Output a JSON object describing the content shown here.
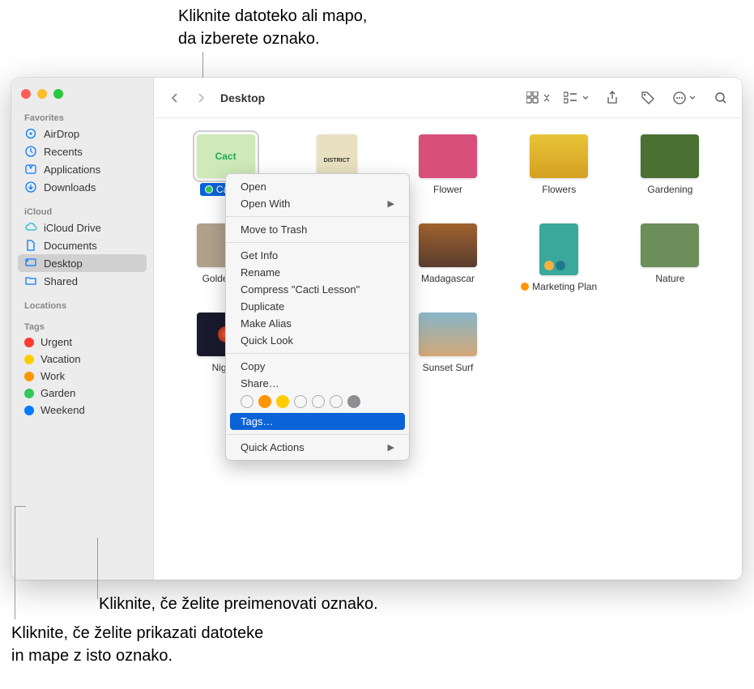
{
  "annotations": {
    "top": "Kliknite datoteko ali mapo,\nda izberete oznako.",
    "rename": "Kliknite, če želite preimenovati oznako.",
    "showfiles": "Kliknite, če želite prikazati datoteke\nin mape z isto oznako."
  },
  "window": {
    "title": "Desktop"
  },
  "sidebar": {
    "sections": {
      "favorites": {
        "title": "Favorites",
        "items": [
          "AirDrop",
          "Recents",
          "Applications",
          "Downloads"
        ]
      },
      "icloud": {
        "title": "iCloud",
        "items": [
          "iCloud Drive",
          "Documents",
          "Desktop",
          "Shared"
        ]
      },
      "locations": {
        "title": "Locations"
      },
      "tags": {
        "title": "Tags",
        "items": [
          {
            "label": "Urgent",
            "color": "#ff3b30"
          },
          {
            "label": "Vacation",
            "color": "#ffcc00"
          },
          {
            "label": "Work",
            "color": "#ff9500"
          },
          {
            "label": "Garden",
            "color": "#34c759"
          },
          {
            "label": "Weekend",
            "color": "#007aff"
          }
        ]
      }
    }
  },
  "files": [
    {
      "label": "Cacti L",
      "selected": true,
      "tag": "#34c759",
      "thumb": "#cfe9b8",
      "text": "Cact"
    },
    {
      "label": "District",
      "thumb": "#e8e0c0",
      "text": "DISTRICT"
    },
    {
      "label": "Flower",
      "thumb": "#d94f7b"
    },
    {
      "label": "Flowers",
      "thumb": "#e8c437"
    },
    {
      "label": "Gardening",
      "thumb": "#4a7032"
    },
    {
      "label": "Golden Ga",
      "thumb": "#b0a08c"
    },
    {
      "label": "",
      "thumb": ""
    },
    {
      "label": "Madagascar",
      "thumb": "#5a3d2e"
    },
    {
      "label": "Marketing Plan",
      "tag": "#ff9500",
      "thumb": "#3aa89a",
      "tall": true
    },
    {
      "label": "Nature",
      "thumb": "#6b8e5a"
    },
    {
      "label": "Nightti",
      "thumb": "#1a1a2e"
    },
    {
      "label": "",
      "thumb": ""
    },
    {
      "label": "Sunset Surf",
      "thumb": "#87b5c9"
    }
  ],
  "contextMenu": {
    "items": [
      {
        "label": "Open"
      },
      {
        "label": "Open With",
        "submenu": true
      },
      {
        "sep": true
      },
      {
        "label": "Move to Trash"
      },
      {
        "sep": true
      },
      {
        "label": "Get Info"
      },
      {
        "label": "Rename"
      },
      {
        "label": "Compress \"Cacti Lesson\""
      },
      {
        "label": "Duplicate"
      },
      {
        "label": "Make Alias"
      },
      {
        "label": "Quick Look"
      },
      {
        "sep": true
      },
      {
        "label": "Copy"
      },
      {
        "label": "Share…"
      },
      {
        "tagrow": true,
        "colors": [
          "",
          "#ff9500",
          "#ffcc00",
          "",
          "",
          "",
          "#8e8e93"
        ]
      },
      {
        "label": "Tags…",
        "highlighted": true
      },
      {
        "sep": true
      },
      {
        "label": "Quick Actions",
        "submenu": true
      }
    ]
  }
}
